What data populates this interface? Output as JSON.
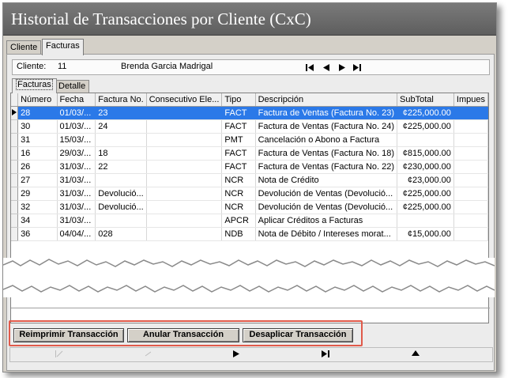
{
  "window": {
    "title": "Historial de Transacciones por Cliente (CxC)"
  },
  "outer_tabs": [
    {
      "label": "Cliente",
      "active": false
    },
    {
      "label": "Facturas",
      "active": true
    }
  ],
  "client": {
    "label": "Cliente:",
    "id": "11",
    "name": "Brenda Garcia Madrigal"
  },
  "nav_icons": [
    "first-record-icon",
    "previous-record-icon",
    "next-record-icon",
    "last-record-icon"
  ],
  "inner_tabs": [
    {
      "label": "Facturas",
      "active": true
    },
    {
      "label": "Detalle",
      "active": false
    }
  ],
  "grid": {
    "columns": [
      "Número",
      "Fecha",
      "Factura No.",
      "Consecutivo Ele...",
      "Tipo",
      "Descripción",
      "SubTotal",
      "Impues"
    ],
    "selected_row": 0,
    "rows": [
      {
        "numero": "28",
        "fecha": "01/03/...",
        "factura": "23",
        "consecutivo": "",
        "tipo": "FACT",
        "descripcion": "Factura de Ventas (Factura No. 23)",
        "subtotal": "¢225,000.00",
        "impuesto": ""
      },
      {
        "numero": "30",
        "fecha": "01/03/...",
        "factura": "24",
        "consecutivo": "",
        "tipo": "FACT",
        "descripcion": "Factura de Ventas (Factura No. 24)",
        "subtotal": "¢225,000.00",
        "impuesto": ""
      },
      {
        "numero": "31",
        "fecha": "15/03/...",
        "factura": "",
        "consecutivo": "",
        "tipo": "PMT",
        "descripcion": "Cancelación o Abono a Factura",
        "subtotal": "",
        "impuesto": ""
      },
      {
        "numero": "16",
        "fecha": "29/03/...",
        "factura": "18",
        "consecutivo": "",
        "tipo": "FACT",
        "descripcion": "Factura de Ventas (Factura No. 18)",
        "subtotal": "¢815,000.00",
        "impuesto": ""
      },
      {
        "numero": "26",
        "fecha": "31/03/...",
        "factura": "22",
        "consecutivo": "",
        "tipo": "FACT",
        "descripcion": "Factura de Ventas (Factura No. 22)",
        "subtotal": "¢230,000.00",
        "impuesto": ""
      },
      {
        "numero": "27",
        "fecha": "31/03/...",
        "factura": "",
        "consecutivo": "",
        "tipo": "NCR",
        "descripcion": "Nota de Crédito",
        "subtotal": "¢23,000.00",
        "impuesto": ""
      },
      {
        "numero": "29",
        "fecha": "31/03/...",
        "factura": "Devolució...",
        "consecutivo": "",
        "tipo": "NCR",
        "descripcion": "Devolución de Ventas (Devolució...",
        "subtotal": "¢225,000.00",
        "impuesto": ""
      },
      {
        "numero": "32",
        "fecha": "31/03/...",
        "factura": "Devolució...",
        "consecutivo": "",
        "tipo": "NCR",
        "descripcion": "Devolución de Ventas (Devolució...",
        "subtotal": "¢225,000.00",
        "impuesto": ""
      },
      {
        "numero": "34",
        "fecha": "31/03/...",
        "factura": "",
        "consecutivo": "",
        "tipo": "APCR",
        "descripcion": "Aplicar Créditos a Facturas",
        "subtotal": "",
        "impuesto": ""
      },
      {
        "numero": "36",
        "fecha": "04/04/...",
        "factura": "028",
        "consecutivo": "",
        "tipo": "NDB",
        "descripcion": "Nota de Débito / Intereses morat...",
        "subtotal": "¢15,000.00",
        "impuesto": ""
      }
    ]
  },
  "buttons": {
    "reprint": "Reimprimir Transacción",
    "void": "Anular Transacción",
    "unapply": "Desaplicar Transacción"
  },
  "colors": {
    "selection": "#2b79e8",
    "highlight_border": "#e05a4a",
    "titlebar": "#6a6a6a"
  }
}
